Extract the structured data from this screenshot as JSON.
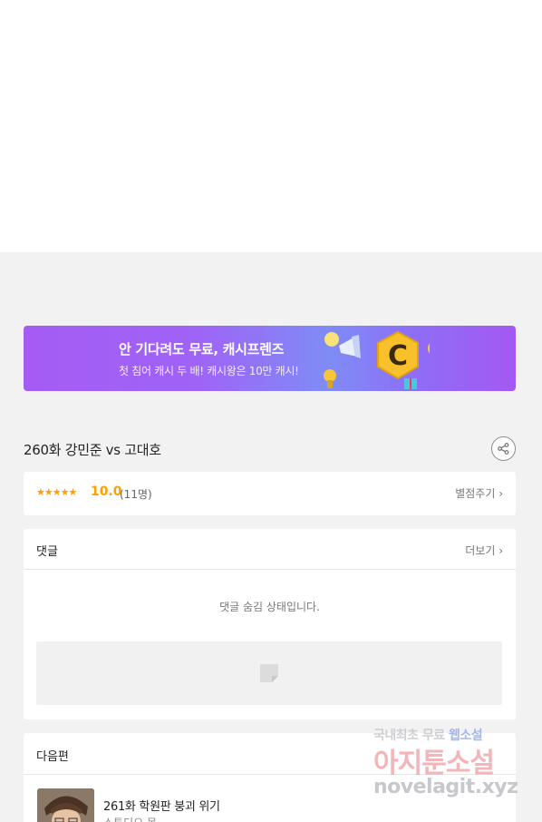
{
  "banner": {
    "title": "안 기다려도 무료, 캐시프렌즈",
    "subtitle": "첫 침어 캐시 두 배! 캐시왕은 10만 캐시!",
    "logo_letter": "C"
  },
  "episode": {
    "title": "260화 강민준 vs 고대호",
    "share_icon": "share-icon"
  },
  "rating": {
    "stars": "★★★★★",
    "score": "10.0",
    "count": "(11명)",
    "rate_link": "별점주기 ›",
    "star_color": "#ff9f00"
  },
  "comments": {
    "header": "댓글",
    "more_link": "더보기 ›",
    "hidden_message": "댓글 숨김 상태입니다."
  },
  "next": {
    "header": "다음편",
    "episode_title": "261화 학원판 붕괴 위기",
    "author": "스튜디오 몽"
  },
  "watermark": {
    "line1_a": "국내최초 무료 ",
    "line1_b": "웹소설",
    "line2": "아지툰소설",
    "line3": "novelagit.xyz"
  }
}
